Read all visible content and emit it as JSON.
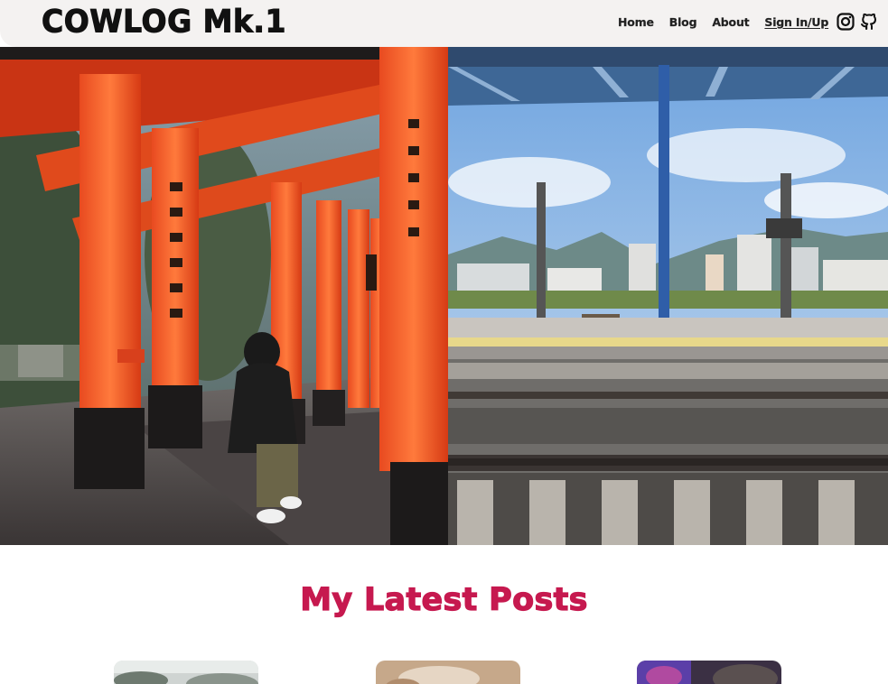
{
  "header": {
    "logo": "COWLOG Mk.1",
    "nav": [
      "Home",
      "Blog",
      "About",
      "Sign In/Up"
    ]
  },
  "social": {
    "icons": [
      "instagram-icon",
      "github-icon"
    ]
  },
  "hero": {
    "images": [
      "torii-gates-photo",
      "train-station-photo"
    ]
  },
  "latest": {
    "title": "My Latest Posts"
  },
  "colors": {
    "accent": "#c6194f",
    "header_bg": "#f4f2f1"
  }
}
